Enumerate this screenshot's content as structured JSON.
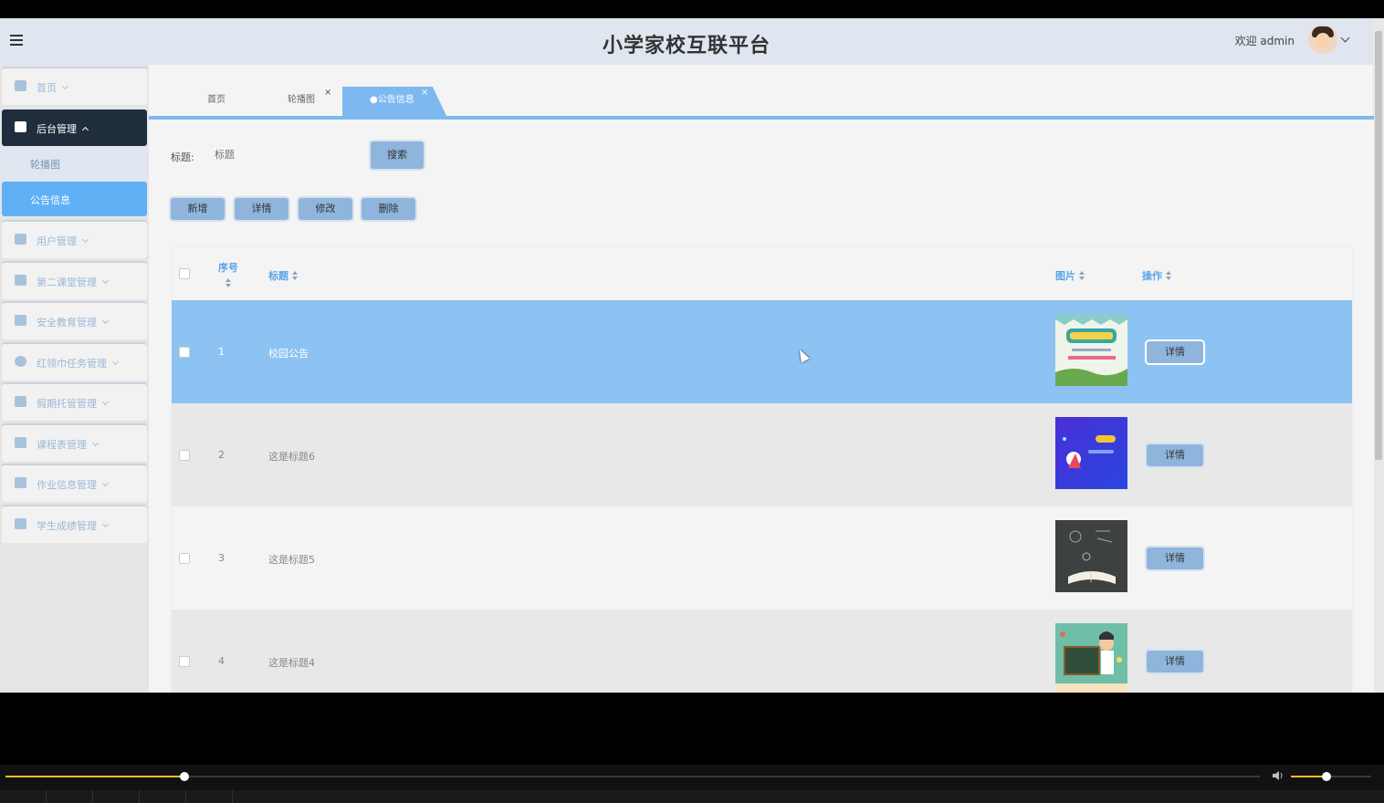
{
  "app": {
    "title": "小学家校互联平台",
    "welcome": "欢迎 admin"
  },
  "sidebar": {
    "items": [
      {
        "label": "首页",
        "icon": "home-icon"
      },
      {
        "label": "后台管理",
        "icon": "grid-icon",
        "active": true
      },
      {
        "label": "用户管理",
        "icon": "users-icon"
      },
      {
        "label": "第二课堂管理",
        "icon": "classroom-icon"
      },
      {
        "label": "安全教育管理",
        "icon": "safety-icon"
      },
      {
        "label": "红领巾任务管理",
        "icon": "task-icon"
      },
      {
        "label": "假期托管管理",
        "icon": "holiday-icon"
      },
      {
        "label": "课程表管理",
        "icon": "schedule-icon"
      },
      {
        "label": "作业信息管理",
        "icon": "homework-icon"
      },
      {
        "label": "学生成绩管理",
        "icon": "grades-icon"
      }
    ],
    "subitems": [
      {
        "label": "轮播图"
      },
      {
        "label": "公告信息",
        "active": true
      }
    ]
  },
  "tabs": [
    {
      "label": "首页"
    },
    {
      "label": "轮播图",
      "close": "×"
    },
    {
      "label": "●公告信息",
      "close": "×",
      "active": true
    }
  ],
  "search": {
    "label": "标题:",
    "placeholder": "标题",
    "button": "搜索"
  },
  "actions": {
    "add": "新增",
    "detail": "详情",
    "edit": "修改",
    "delete": "删除"
  },
  "table": {
    "headers": {
      "index": "序号",
      "title": "标题",
      "image": "图片",
      "operation": "操作"
    },
    "rows": [
      {
        "index": "1",
        "title": "校园公告",
        "button": "详情",
        "selected": true
      },
      {
        "index": "2",
        "title": "这是标题6",
        "button": "详情"
      },
      {
        "index": "3",
        "title": "这是标题5",
        "button": "详情"
      },
      {
        "index": "4",
        "title": "这是标题4",
        "button": "详情"
      }
    ]
  },
  "player": {
    "progress": 0.14,
    "volume": 0.45,
    "accent": "#f0c020"
  },
  "colors": {
    "accent": "#7db9f0",
    "sidebar_active": "#1f2d3d",
    "selected_row": "#8cc3f2"
  }
}
